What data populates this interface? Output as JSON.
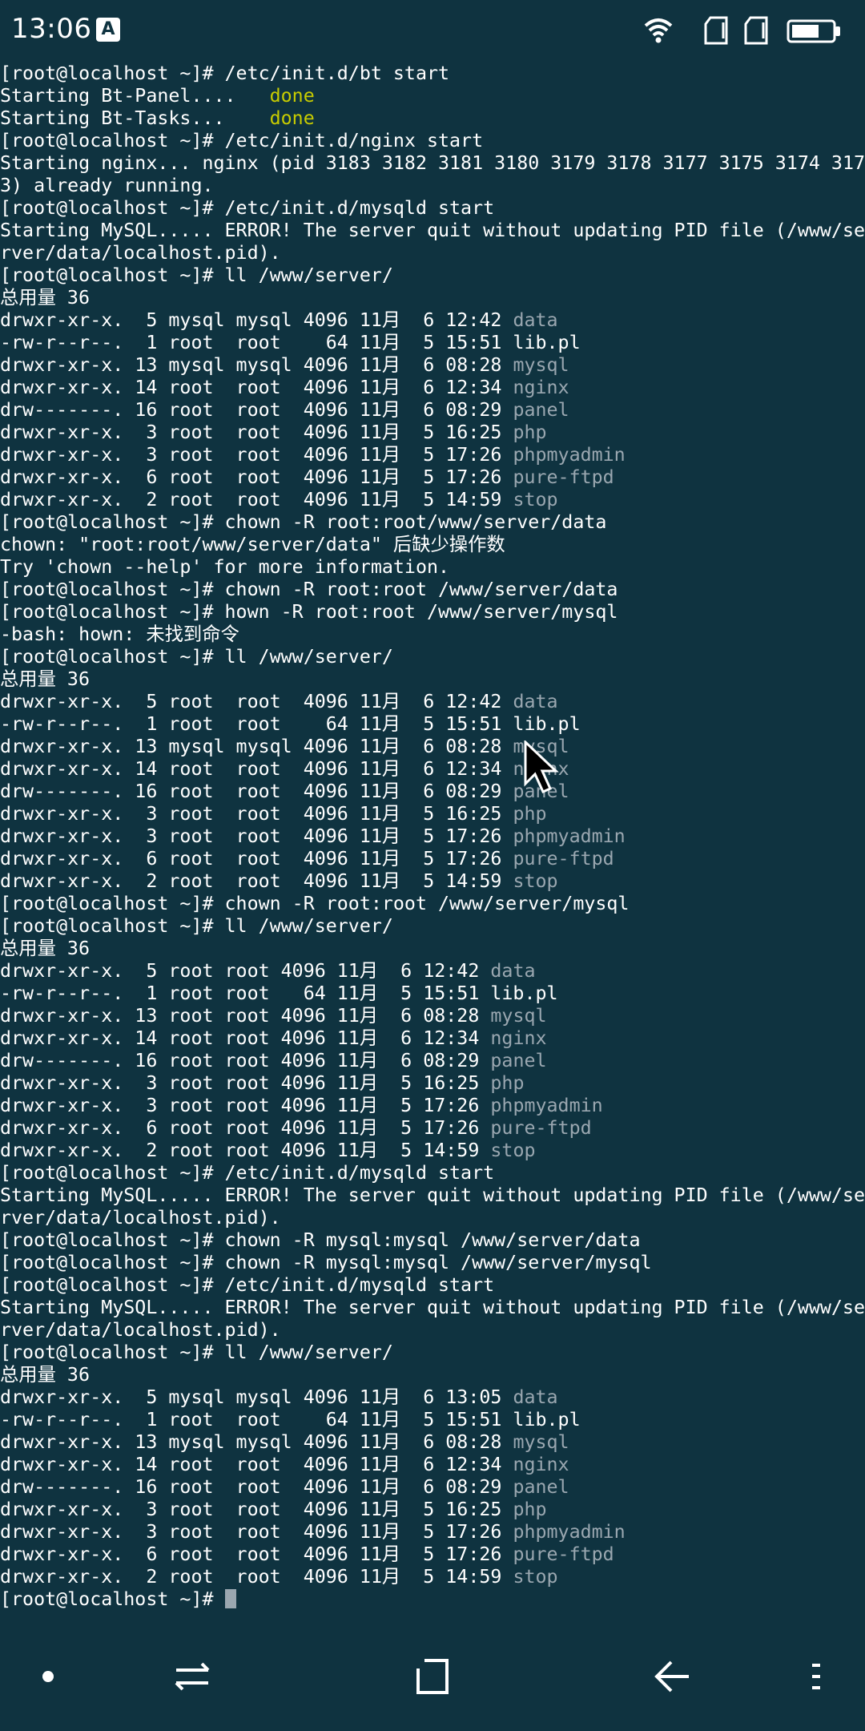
{
  "status_bar": {
    "time": "13:06",
    "app_icon_letter": "A",
    "icons": [
      "wifi-icon",
      "sim1-no-signal-icon",
      "sim2-no-signal-icon",
      "battery-icon"
    ]
  },
  "colors": {
    "background": "#0f3340",
    "text": "#ffffff",
    "done": "#c8cc00",
    "directory": "#9aa7b0"
  },
  "terminal": {
    "lines": [
      [
        {
          "t": "[root@localhost ~]# /etc/init.d/bt start",
          "c": ""
        }
      ],
      [
        {
          "t": "Starting Bt-Panel....   ",
          "c": ""
        },
        {
          "t": "done",
          "c": "done"
        }
      ],
      [
        {
          "t": "Starting Bt-Tasks...    ",
          "c": ""
        },
        {
          "t": "done",
          "c": "done"
        }
      ],
      [
        {
          "t": "[root@localhost ~]# /etc/init.d/nginx start",
          "c": ""
        }
      ],
      [
        {
          "t": "Starting nginx... nginx (pid 3183 3182 3181 3180 3179 3178 3177 3175 3174 317",
          "c": ""
        }
      ],
      [
        {
          "t": "3) already running.",
          "c": ""
        }
      ],
      [
        {
          "t": "[root@localhost ~]# /etc/init.d/mysqld start",
          "c": ""
        }
      ],
      [
        {
          "t": "Starting MySQL..... ERROR! The server quit without updating PID file (/www/se",
          "c": ""
        }
      ],
      [
        {
          "t": "rver/data/localhost.pid).",
          "c": ""
        }
      ],
      [
        {
          "t": "[root@localhost ~]# ll /www/server/",
          "c": ""
        }
      ],
      [
        {
          "t": "总用量 36",
          "c": ""
        }
      ],
      [
        {
          "t": "drwxr-xr-x.  5 mysql mysql 4096 11月  6 12:42 ",
          "c": ""
        },
        {
          "t": "data",
          "c": "dir"
        }
      ],
      [
        {
          "t": "-rw-r--r--.  1 root  root    64 11月  5 15:51 lib.pl",
          "c": ""
        }
      ],
      [
        {
          "t": "drwxr-xr-x. 13 mysql mysql 4096 11月  6 08:28 ",
          "c": ""
        },
        {
          "t": "mysql",
          "c": "dir"
        }
      ],
      [
        {
          "t": "drwxr-xr-x. 14 root  root  4096 11月  6 12:34 ",
          "c": ""
        },
        {
          "t": "nginx",
          "c": "dir"
        }
      ],
      [
        {
          "t": "drw-------. 16 root  root  4096 11月  6 08:29 ",
          "c": ""
        },
        {
          "t": "panel",
          "c": "dir"
        }
      ],
      [
        {
          "t": "drwxr-xr-x.  3 root  root  4096 11月  5 16:25 ",
          "c": ""
        },
        {
          "t": "php",
          "c": "dir"
        }
      ],
      [
        {
          "t": "drwxr-xr-x.  3 root  root  4096 11月  5 17:26 ",
          "c": ""
        },
        {
          "t": "phpmyadmin",
          "c": "dir"
        }
      ],
      [
        {
          "t": "drwxr-xr-x.  6 root  root  4096 11月  5 17:26 ",
          "c": ""
        },
        {
          "t": "pure-ftpd",
          "c": "dir"
        }
      ],
      [
        {
          "t": "drwxr-xr-x.  2 root  root  4096 11月  5 14:59 ",
          "c": ""
        },
        {
          "t": "stop",
          "c": "dir"
        }
      ],
      [
        {
          "t": "[root@localhost ~]# chown -R root:root/www/server/data",
          "c": ""
        }
      ],
      [
        {
          "t": "chown: \"root:root/www/server/data\" 后缺少操作数",
          "c": ""
        }
      ],
      [
        {
          "t": "Try 'chown --help' for more information.",
          "c": ""
        }
      ],
      [
        {
          "t": "[root@localhost ~]# chown -R root:root /www/server/data",
          "c": ""
        }
      ],
      [
        {
          "t": "[root@localhost ~]# hown -R root:root /www/server/mysql",
          "c": ""
        }
      ],
      [
        {
          "t": "-bash: hown: 未找到命令",
          "c": ""
        }
      ],
      [
        {
          "t": "[root@localhost ~]# ll /www/server/",
          "c": ""
        }
      ],
      [
        {
          "t": "总用量 36",
          "c": ""
        }
      ],
      [
        {
          "t": "drwxr-xr-x.  5 root  root  4096 11月  6 12:42 ",
          "c": ""
        },
        {
          "t": "data",
          "c": "dir"
        }
      ],
      [
        {
          "t": "-rw-r--r--.  1 root  root    64 11月  5 15:51 lib.pl",
          "c": ""
        }
      ],
      [
        {
          "t": "drwxr-xr-x. 13 mysql mysql 4096 11月  6 08:28 ",
          "c": ""
        },
        {
          "t": "mysql",
          "c": "dir"
        }
      ],
      [
        {
          "t": "drwxr-xr-x. 14 root  root  4096 11月  6 12:34 ",
          "c": ""
        },
        {
          "t": "nginx",
          "c": "dir"
        }
      ],
      [
        {
          "t": "drw-------. 16 root  root  4096 11月  6 08:29 ",
          "c": ""
        },
        {
          "t": "panel",
          "c": "dir"
        }
      ],
      [
        {
          "t": "drwxr-xr-x.  3 root  root  4096 11月  5 16:25 ",
          "c": ""
        },
        {
          "t": "php",
          "c": "dir"
        }
      ],
      [
        {
          "t": "drwxr-xr-x.  3 root  root  4096 11月  5 17:26 ",
          "c": ""
        },
        {
          "t": "phpmyadmin",
          "c": "dir"
        }
      ],
      [
        {
          "t": "drwxr-xr-x.  6 root  root  4096 11月  5 17:26 ",
          "c": ""
        },
        {
          "t": "pure-ftpd",
          "c": "dir"
        }
      ],
      [
        {
          "t": "drwxr-xr-x.  2 root  root  4096 11月  5 14:59 ",
          "c": ""
        },
        {
          "t": "stop",
          "c": "dir"
        }
      ],
      [
        {
          "t": "[root@localhost ~]# chown -R root:root /www/server/mysql",
          "c": ""
        }
      ],
      [
        {
          "t": "[root@localhost ~]# ll /www/server/",
          "c": ""
        }
      ],
      [
        {
          "t": "总用量 36",
          "c": ""
        }
      ],
      [
        {
          "t": "drwxr-xr-x.  5 root root 4096 11月  6 12:42 ",
          "c": ""
        },
        {
          "t": "data",
          "c": "dir"
        }
      ],
      [
        {
          "t": "-rw-r--r--.  1 root root   64 11月  5 15:51 lib.pl",
          "c": ""
        }
      ],
      [
        {
          "t": "drwxr-xr-x. 13 root root 4096 11月  6 08:28 ",
          "c": ""
        },
        {
          "t": "mysql",
          "c": "dir"
        }
      ],
      [
        {
          "t": "drwxr-xr-x. 14 root root 4096 11月  6 12:34 ",
          "c": ""
        },
        {
          "t": "nginx",
          "c": "dir"
        }
      ],
      [
        {
          "t": "drw-------. 16 root root 4096 11月  6 08:29 ",
          "c": ""
        },
        {
          "t": "panel",
          "c": "dir"
        }
      ],
      [
        {
          "t": "drwxr-xr-x.  3 root root 4096 11月  5 16:25 ",
          "c": ""
        },
        {
          "t": "php",
          "c": "dir"
        }
      ],
      [
        {
          "t": "drwxr-xr-x.  3 root root 4096 11月  5 17:26 ",
          "c": ""
        },
        {
          "t": "phpmyadmin",
          "c": "dir"
        }
      ],
      [
        {
          "t": "drwxr-xr-x.  6 root root 4096 11月  5 17:26 ",
          "c": ""
        },
        {
          "t": "pure-ftpd",
          "c": "dir"
        }
      ],
      [
        {
          "t": "drwxr-xr-x.  2 root root 4096 11月  5 14:59 ",
          "c": ""
        },
        {
          "t": "stop",
          "c": "dir"
        }
      ],
      [
        {
          "t": "[root@localhost ~]# /etc/init.d/mysqld start",
          "c": ""
        }
      ],
      [
        {
          "t": "Starting MySQL..... ERROR! The server quit without updating PID file (/www/se",
          "c": ""
        }
      ],
      [
        {
          "t": "rver/data/localhost.pid).",
          "c": ""
        }
      ],
      [
        {
          "t": "[root@localhost ~]# chown -R mysql:mysql /www/server/data",
          "c": ""
        }
      ],
      [
        {
          "t": "[root@localhost ~]# chown -R mysql:mysql /www/server/mysql",
          "c": ""
        }
      ],
      [
        {
          "t": "[root@localhost ~]# /etc/init.d/mysqld start",
          "c": ""
        }
      ],
      [
        {
          "t": "Starting MySQL..... ERROR! The server quit without updating PID file (/www/se",
          "c": ""
        }
      ],
      [
        {
          "t": "rver/data/localhost.pid).",
          "c": ""
        }
      ],
      [
        {
          "t": "[root@localhost ~]# ll /www/server/",
          "c": ""
        }
      ],
      [
        {
          "t": "总用量 36",
          "c": ""
        }
      ],
      [
        {
          "t": "drwxr-xr-x.  5 mysql mysql 4096 11月  6 13:05 ",
          "c": ""
        },
        {
          "t": "data",
          "c": "dir"
        }
      ],
      [
        {
          "t": "-rw-r--r--.  1 root  root    64 11月  5 15:51 lib.pl",
          "c": ""
        }
      ],
      [
        {
          "t": "drwxr-xr-x. 13 mysql mysql 4096 11月  6 08:28 ",
          "c": ""
        },
        {
          "t": "mysql",
          "c": "dir"
        }
      ],
      [
        {
          "t": "drwxr-xr-x. 14 root  root  4096 11月  6 12:34 ",
          "c": ""
        },
        {
          "t": "nginx",
          "c": "dir"
        }
      ],
      [
        {
          "t": "drw-------. 16 root  root  4096 11月  6 08:29 ",
          "c": ""
        },
        {
          "t": "panel",
          "c": "dir"
        }
      ],
      [
        {
          "t": "drwxr-xr-x.  3 root  root  4096 11月  5 16:25 ",
          "c": ""
        },
        {
          "t": "php",
          "c": "dir"
        }
      ],
      [
        {
          "t": "drwxr-xr-x.  3 root  root  4096 11月  5 17:26 ",
          "c": ""
        },
        {
          "t": "phpmyadmin",
          "c": "dir"
        }
      ],
      [
        {
          "t": "drwxr-xr-x.  6 root  root  4096 11月  5 17:26 ",
          "c": ""
        },
        {
          "t": "pure-ftpd",
          "c": "dir"
        }
      ],
      [
        {
          "t": "drwxr-xr-x.  2 root  root  4096 11月  5 14:59 ",
          "c": ""
        },
        {
          "t": "stop",
          "c": "dir"
        }
      ]
    ],
    "prompt": "[root@localhost ~]# "
  },
  "nav_bar": {
    "buttons": [
      "dot-icon",
      "switch-arrows-icon",
      "home-square-icon",
      "back-arrow-icon",
      "menu-dots-icon"
    ]
  }
}
